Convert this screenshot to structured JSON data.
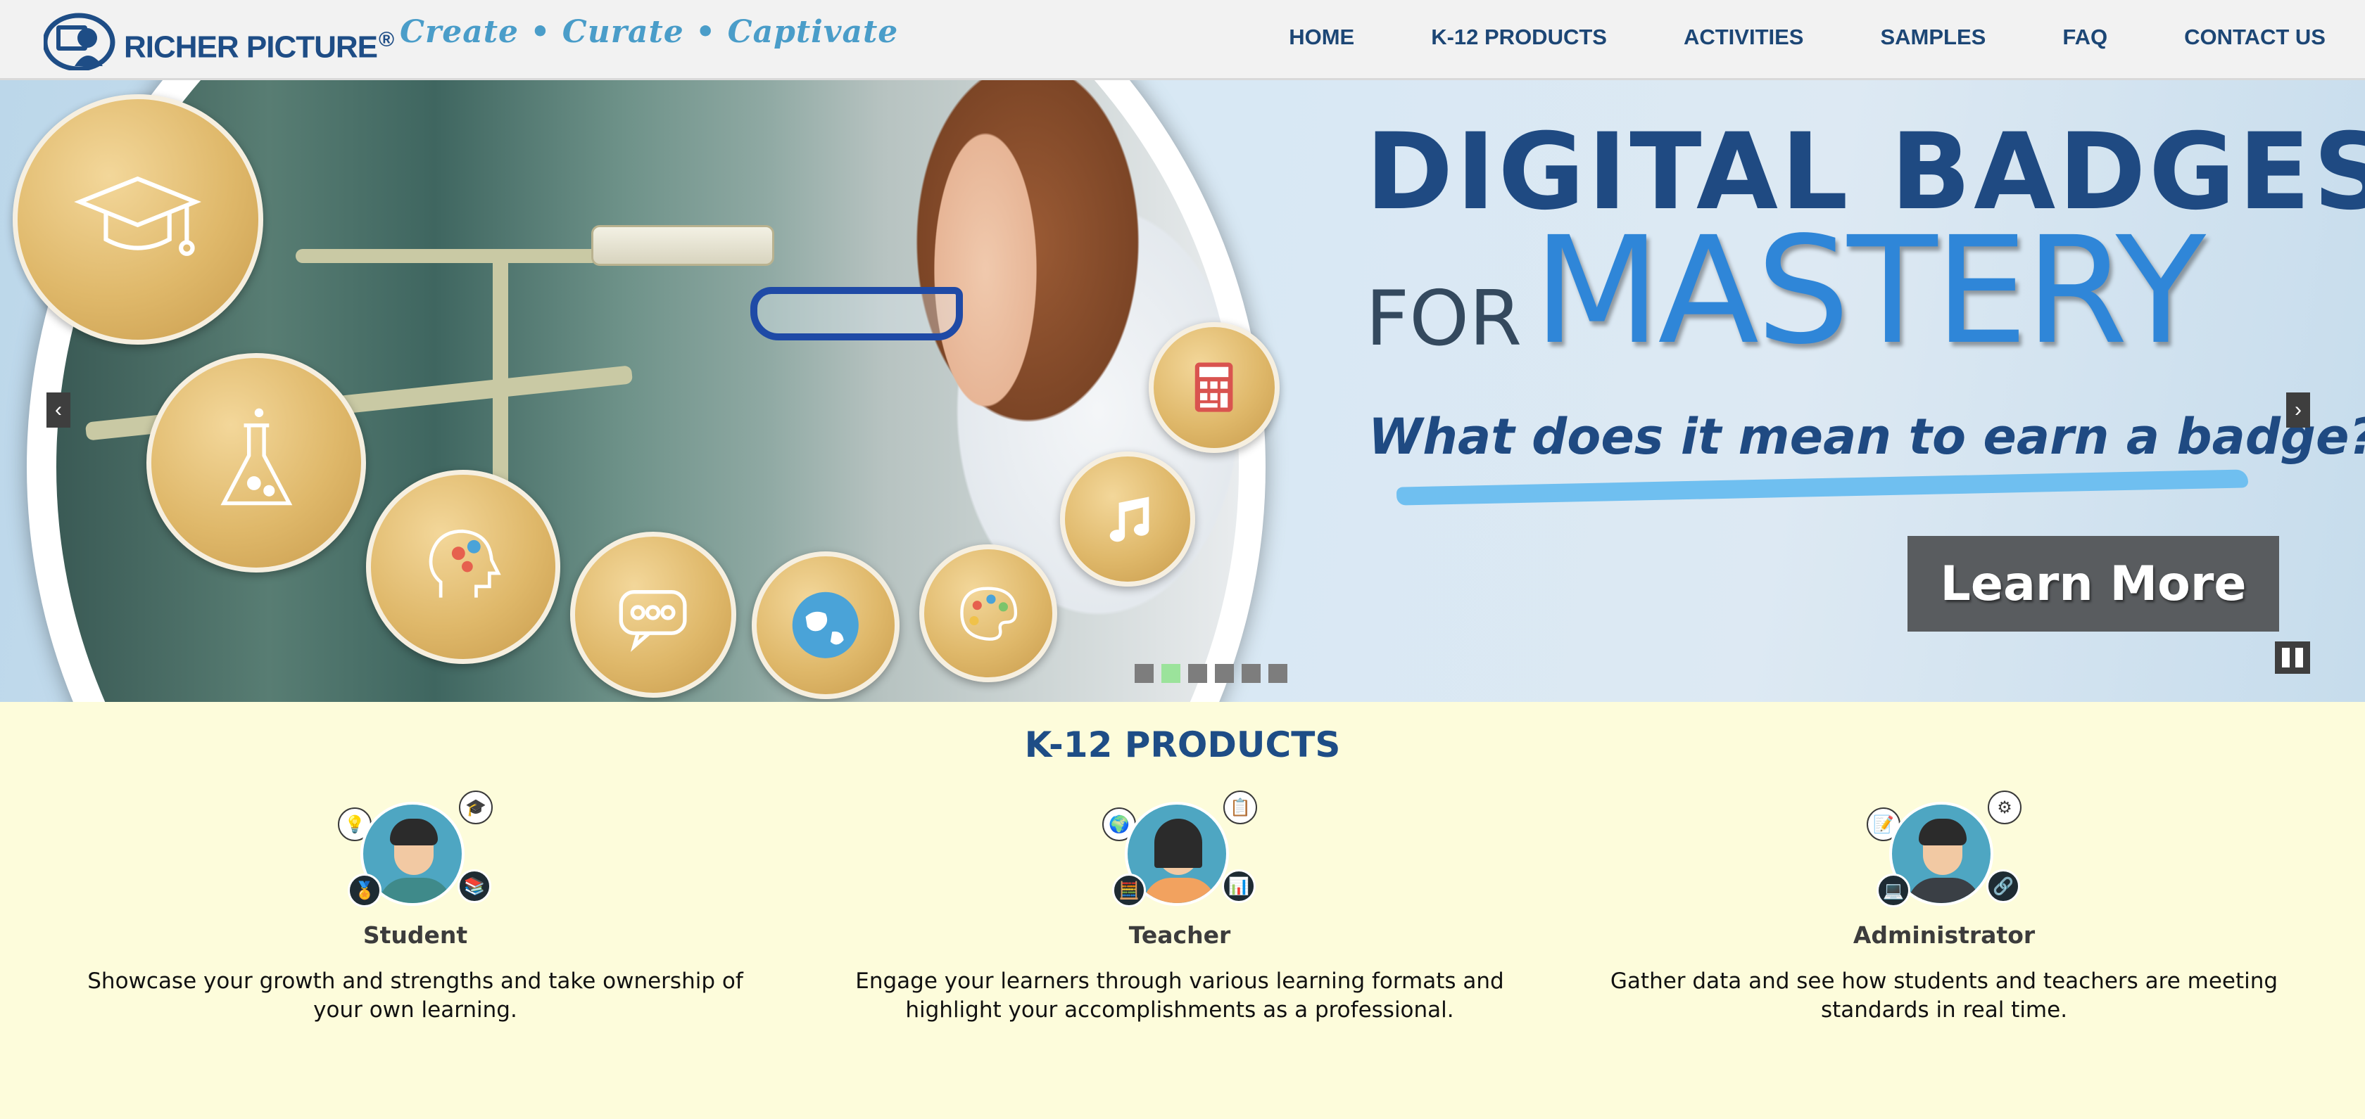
{
  "header": {
    "brand": "RICHER PICTURE",
    "brand_reg": "®",
    "tagline": "Create • Curate • Captivate",
    "nav": [
      "HOME",
      "K-12 PRODUCTS",
      "ACTIVITIES",
      "SAMPLES",
      "FAQ",
      "CONTACT US"
    ]
  },
  "hero": {
    "line1": "DIGITAL BADGES",
    "line2_for": "FOR",
    "line2_mastery": "MASTERY",
    "question": "What does it mean to earn a badge?",
    "cta": "Learn More",
    "prev_arrow": "‹",
    "next_arrow": "›",
    "slides_count": 6,
    "active_slide": 2,
    "badge_icons": [
      "graduation-cap-icon",
      "flask-icon",
      "brain-gears-icon",
      "speech-bubble-icon",
      "globe-icon",
      "palette-icon",
      "music-note-icon",
      "calculator-icon"
    ]
  },
  "products": {
    "title": "K-12 PRODUCTS",
    "items": [
      {
        "name": "Student",
        "desc": "Showcase your growth and strengths and take ownership of your own learning."
      },
      {
        "name": "Teacher",
        "desc": "Engage your learners through various learning formats and highlight your accomplishments as a professional."
      },
      {
        "name": "Administrator",
        "desc": "Gather data and see how students and teachers are meeting standards in real time."
      }
    ]
  },
  "colors": {
    "nav_text": "#1c4675",
    "brand_blue": "#1e4d86",
    "tagline": "#4a9dc9",
    "mastery": "#2f86d8",
    "products_bg": "#fdfcdb",
    "cta_bg": "#595c5f",
    "active_dot": "#9be39b"
  }
}
